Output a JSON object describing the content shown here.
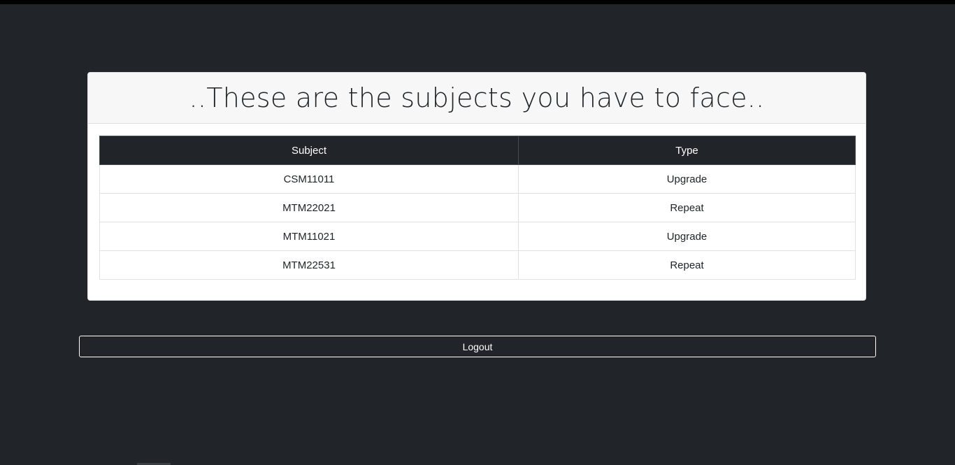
{
  "card": {
    "title": "..These are the subjects you have to face.."
  },
  "table": {
    "headers": {
      "subject": "Subject",
      "type": "Type"
    },
    "rows": [
      {
        "subject": "CSM11011",
        "type": "Upgrade"
      },
      {
        "subject": "MTM22021",
        "type": "Repeat"
      },
      {
        "subject": "MTM11021",
        "type": "Upgrade"
      },
      {
        "subject": "MTM22531",
        "type": "Repeat"
      }
    ]
  },
  "actions": {
    "logout_label": "Logout"
  },
  "colors": {
    "background": "#212529",
    "header_row": "#212529",
    "card": "#ffffff",
    "card_header": "#f7f7f7"
  }
}
